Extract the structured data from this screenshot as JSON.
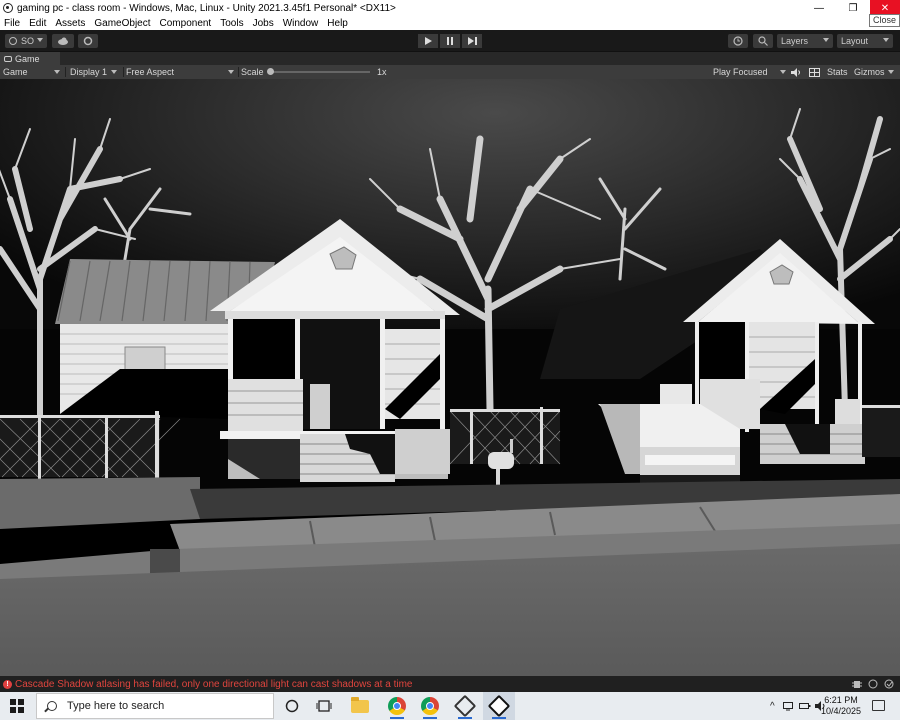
{
  "window": {
    "title": "gaming pc - class room - Windows, Mac, Linux - Unity 2021.3.45f1 Personal* <DX11>",
    "minimize_glyph": "—",
    "restore_glyph": "❐",
    "close_glyph": "✕",
    "close_tooltip": "Close"
  },
  "menu": [
    "File",
    "Edit",
    "Assets",
    "GameObject",
    "Component",
    "Tools",
    "Jobs",
    "Window",
    "Help"
  ],
  "toolbar": {
    "account_label": "SO",
    "layers_label": "Layers",
    "layout_label": "Layout"
  },
  "game_tab": {
    "label": "Game"
  },
  "game_bar": {
    "mode": "Game",
    "display": "Display 1",
    "aspect": "Free Aspect",
    "scale_label": "Scale",
    "scale_value": "1x",
    "play_mode": "Play Focused",
    "stats": "Stats",
    "gizmos": "Gizmos"
  },
  "console": {
    "message": "Cascade Shadow atlasing has failed, only one directional light can cast shadows at a time"
  },
  "taskbar": {
    "search_placeholder": "Type here to search",
    "time": "6:21 PM",
    "date": "10/4/2025",
    "tray_chevron": "^"
  },
  "colors": {
    "error": "#e0453e",
    "close_button": "#e81123",
    "editor_dark": "#191919",
    "panel": "#3c3c3c"
  }
}
